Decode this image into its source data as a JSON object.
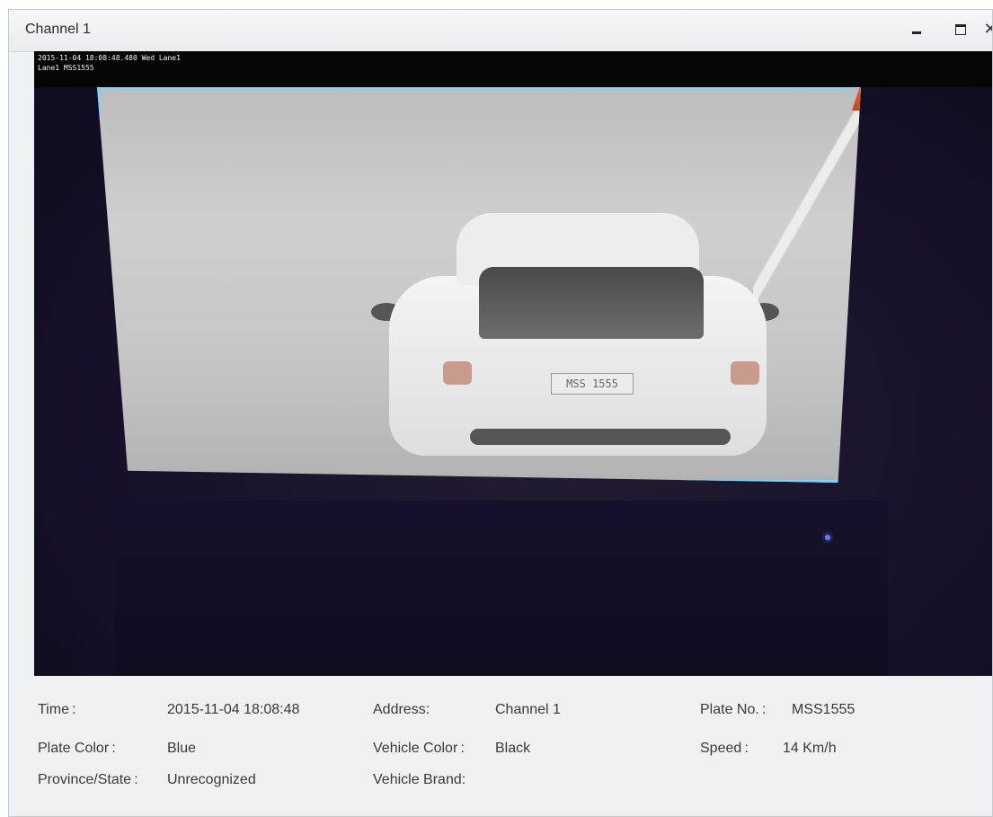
{
  "window": {
    "title": "Channel 1"
  },
  "video": {
    "osd_line1": "2015-11-04 18:08:48.480 Wed Lane1",
    "osd_line2": "Lane1 MSS1555",
    "plate_text": "MSS 1555"
  },
  "info": {
    "time_label": "Time :",
    "time_value": "2015-11-04 18:08:48",
    "address_label": "Address:",
    "address_value": "Channel 1",
    "plate_no_label": "Plate No. :",
    "plate_no_value": "MSS1555",
    "plate_color_label": "Plate Color :",
    "plate_color_value": "Blue",
    "vehicle_color_label": "Vehicle Color :",
    "vehicle_color_value": "Black",
    "speed_label": "Speed :",
    "speed_value": "14 Km/h",
    "province_label": "Province/State :",
    "province_value": "Unrecognized",
    "vehicle_brand_label": "Vehicle Brand:",
    "vehicle_brand_value": ""
  }
}
